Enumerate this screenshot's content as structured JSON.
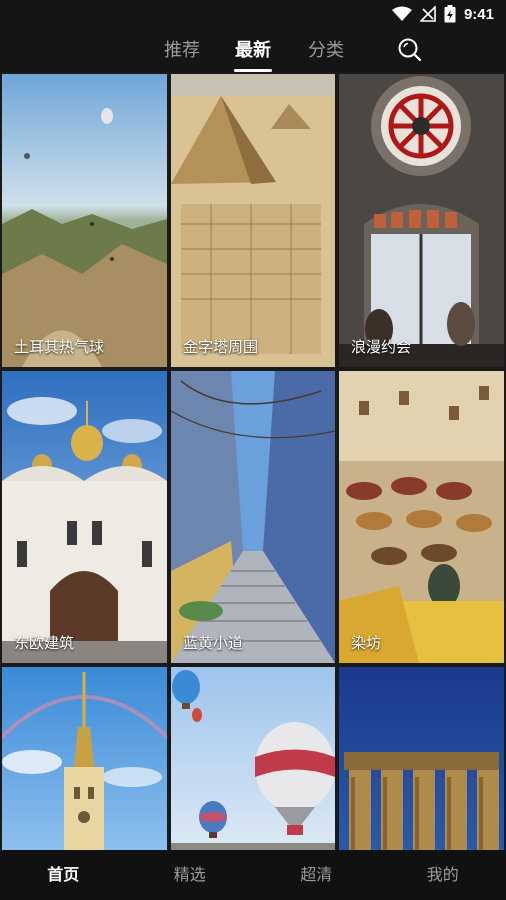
{
  "status_bar": {
    "time": "9:41"
  },
  "top_tabs": [
    {
      "label": "推荐"
    },
    {
      "label": "最新"
    },
    {
      "label": "分类"
    }
  ],
  "active_top_tab": "最新",
  "tiles": [
    {
      "label": "土耳其热气球"
    },
    {
      "label": "金字塔周围"
    },
    {
      "label": "浪漫约会"
    },
    {
      "label": "东欧建筑"
    },
    {
      "label": "蓝黄小道"
    },
    {
      "label": "染坊"
    },
    {
      "label": ""
    },
    {
      "label": ""
    },
    {
      "label": ""
    }
  ],
  "bottom_nav": [
    {
      "label": "首页"
    },
    {
      "label": "精选"
    },
    {
      "label": "超清"
    },
    {
      "label": "我的"
    }
  ],
  "active_bottom_nav": "首页",
  "colors": {
    "background": "#1a1a1a",
    "active_text": "#ffffff",
    "inactive_text": "#9a9a9a"
  }
}
